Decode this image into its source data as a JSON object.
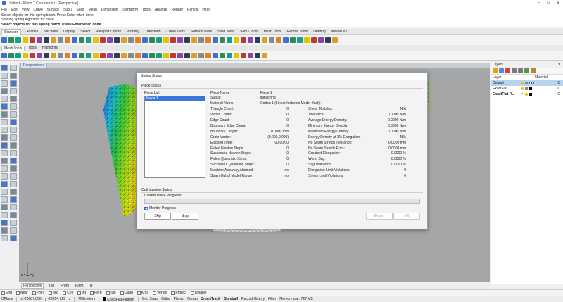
{
  "window": {
    "title": "Untitled - Rhino 7 Commercial - [Perspective]"
  },
  "menu": [
    "File",
    "Edit",
    "View",
    "Curve",
    "Surface",
    "SubD",
    "Solid",
    "Mesh",
    "Dimension",
    "Transform",
    "Tools",
    "Analyze",
    "Render",
    "Panels",
    "Help"
  ],
  "command": {
    "history": [
      "Select objects for this spring batch. Press Enter when done",
      "Starting spring algorithm for piece 1."
    ],
    "prompt": "Select objects for this spring batch. Press Enter when done"
  },
  "toolbar_tabs": [
    "Standard",
    "CPlanes",
    "Set View",
    "Display",
    "Select",
    "Viewport Layout",
    "Visibility",
    "Transform",
    "Curve Tools",
    "Surface Tools",
    "Solid Tools",
    "SubD Tools",
    "Mesh Tools",
    "Render Tools",
    "Drafting",
    "New in V7"
  ],
  "toolbar_tabs2": [
    "Mesh Tools",
    "Tools",
    "Highlights"
  ],
  "viewport": {
    "name": "Perspective"
  },
  "viewport_tabs": [
    "Perspective",
    "Top",
    "Front",
    "Right"
  ],
  "axis_labels": {
    "z": "z",
    "x": "x",
    "y": "y"
  },
  "layers": {
    "title": "Layers",
    "col_layer": "Layer",
    "col_material": "Material",
    "rows": [
      {
        "name": "Default",
        "selected": true,
        "swatch": "#ffffff",
        "mat": "C"
      },
      {
        "name": "ExactFlat ...",
        "selected": false,
        "swatch": "#000000",
        "mat": "C"
      },
      {
        "name": "ExactFlat P...",
        "selected": false,
        "swatch": "#000000",
        "mat": "C",
        "current": "✓"
      }
    ]
  },
  "dialog": {
    "title": "Spring Status",
    "piece_status_label": "Piece Status",
    "piece_list_label": "Piece List:",
    "pieces": [
      "Piece 1"
    ],
    "left_fields": [
      {
        "label": "Piece Name:",
        "value": "Piece 1"
      },
      {
        "label": "Status:",
        "value": "initializing"
      },
      {
        "label": "Material Name:",
        "value": "Cotton 1 (Linear Isotropic Model (fast))"
      },
      {
        "label": "Triangle Count:",
        "value": "0"
      },
      {
        "label": "Vertex Count:",
        "value": "0"
      },
      {
        "label": "Edge Count:",
        "value": "0"
      },
      {
        "label": "Boundary Edge Count:",
        "value": "0"
      },
      {
        "label": "Boundary Length:",
        "value": "0.0000 mm"
      },
      {
        "label": "Grain Vector:",
        "value": "(0.000,0.000)"
      },
      {
        "label": "Elapsed Time:",
        "value": "00:00:00"
      },
      {
        "label": "Failed Newton Steps:",
        "value": "0"
      },
      {
        "label": "Successful Newton Steps:",
        "value": "0"
      },
      {
        "label": "Failed Quadratic Steps:",
        "value": "0"
      },
      {
        "label": "Successful Quadratic Steps:",
        "value": "0"
      },
      {
        "label": "Machine Accuracy Attained:",
        "value": "no"
      },
      {
        "label": "Strain Out of Model Range:",
        "value": "no"
      }
    ],
    "right_fields": [
      {
        "label": "Shear Modulus:",
        "value": "N/A"
      },
      {
        "label": "Tolerance:",
        "value": "0.0000 N/m"
      },
      {
        "label": "Average Energy Density:",
        "value": "0.0000 N/m"
      },
      {
        "label": "Minimum Energy Density:",
        "value": "0.0000 N/m"
      },
      {
        "label": "Maximum Energy Density:",
        "value": "0.0000 N/m"
      },
      {
        "label": "Energy Density at 1% Elongation:",
        "value": "N/A"
      },
      {
        "label": "No Seam Stretch Tolerance:",
        "value": "0.0000 mm"
      },
      {
        "label": "No Seam Stretch Error:",
        "value": "0.0000 mm"
      },
      {
        "label": "Greatest Elongation:",
        "value": "0.0000 %"
      },
      {
        "label": "Worst Sag:",
        "value": "0.0000 %"
      },
      {
        "label": "Sag Tolerance:",
        "value": "0.0000 %"
      },
      {
        "label": "Elongation Limit Violations:",
        "value": "0"
      },
      {
        "label": "Stress Limit Violations:",
        "value": "0"
      }
    ],
    "optimization_label": "Optimization Status",
    "progress_label": "Current Piece Progress:",
    "progress_fraction": 0,
    "monitor_label": "Monitor Progress",
    "buttons": {
      "skip": "Skip",
      "stop": "Stop",
      "export": "Export",
      "ok": "OK"
    }
  },
  "osnaps": [
    "End",
    "Near",
    "Point",
    "Mid",
    "Cen",
    "Int",
    "Perp",
    "Tan",
    "Quad",
    "Knot",
    "Vertex",
    "Project",
    "Disable"
  ],
  "status": {
    "cplane": "CPlane",
    "x": "x -20087.856",
    "y": "y -29814.729",
    "z": "z",
    "units": "Millimeters",
    "layer": "ExactFlat Pattern",
    "items": [
      "Grid Snap",
      "Ortho",
      "Planar",
      "Osnap",
      "SmartTrack",
      "Gumball",
      "Record History",
      "Filter",
      "Memory use: 727 MB"
    ]
  }
}
